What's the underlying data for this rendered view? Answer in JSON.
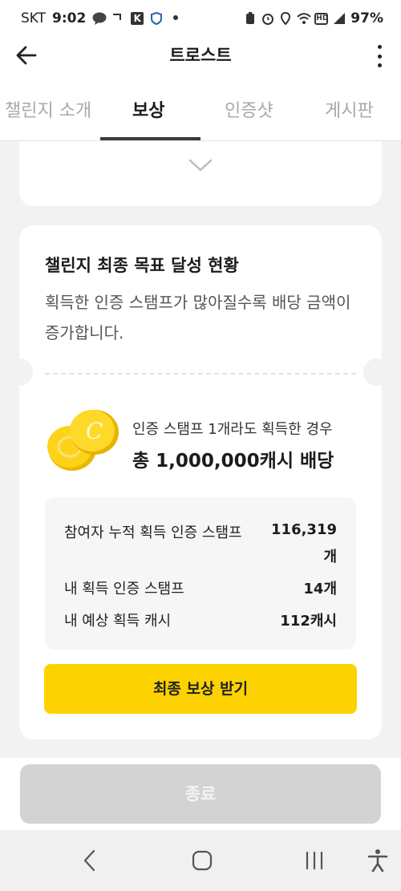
{
  "status_bar": {
    "carrier": "SKT",
    "time": "9:02",
    "battery": "97%"
  },
  "app_bar": {
    "title": "트로스트"
  },
  "tabs": [
    {
      "label": "챌린지 소개",
      "active": false
    },
    {
      "label": "보상",
      "active": true
    },
    {
      "label": "인증샷",
      "active": false
    },
    {
      "label": "게시판",
      "active": false
    }
  ],
  "goal_card": {
    "title": "챌린지 최종 목표 달성 현황",
    "description": "획득한 인증 스탬프가 많아질수록 배당 금액이 증가합니다.",
    "reward_subtitle": "인증 스탬프 1개라도 획득한 경우",
    "reward_main": "총 1,000,000캐시 배당",
    "stats": [
      {
        "label": "참여자 누적 획득 인증 스탬프",
        "value": "116,319",
        "unit": "개"
      },
      {
        "label": "내 획득 인증 스탬프",
        "value": "14개"
      },
      {
        "label": "내 예상 획득 캐시",
        "value": "112캐시"
      }
    ],
    "claim_button": "최종 보상 받기"
  },
  "bottom": {
    "end_button": "종료"
  },
  "colors": {
    "accent_yellow": "#fcd300",
    "disabled_gray": "#d3d3d3",
    "background": "#f2f2f2"
  },
  "icons": [
    "back-arrow-icon",
    "more-vert-icon",
    "chevron-down-icon",
    "coin-icon",
    "nav-back-icon",
    "nav-home-icon",
    "nav-recents-icon",
    "accessibility-icon"
  ]
}
